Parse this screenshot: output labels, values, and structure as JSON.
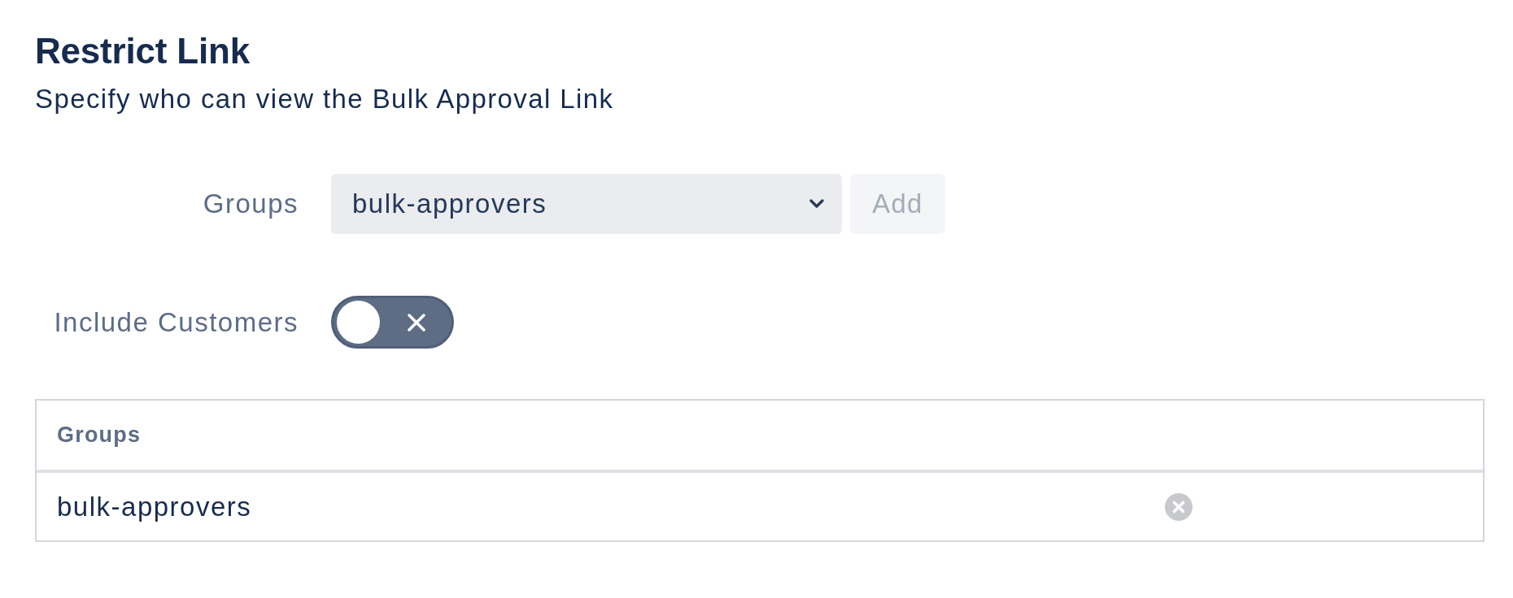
{
  "header": {
    "title": "Restrict Link",
    "subtitle": "Specify who can view the Bulk Approval Link"
  },
  "form": {
    "groups_field": {
      "label": "Groups",
      "value": "bulk-approvers"
    },
    "add_button": {
      "label": "Add",
      "disabled": true
    },
    "include_customers": {
      "label": "Include Customers",
      "on": false
    }
  },
  "table": {
    "columns": [
      "Groups"
    ],
    "rows": [
      {
        "cells": [
          "bulk-approvers"
        ]
      }
    ]
  }
}
